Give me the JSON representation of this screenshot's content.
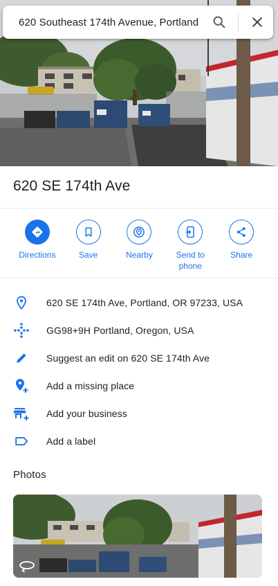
{
  "search": {
    "query": "620 Southeast 174th Avenue, Portland",
    "search_icon": "search-icon",
    "close_icon": "close-icon"
  },
  "place": {
    "title": "620 SE 174th Ave"
  },
  "actions": [
    {
      "label": "Directions",
      "icon": "directions-icon",
      "filled": true
    },
    {
      "label": "Save",
      "icon": "bookmark-icon",
      "filled": false
    },
    {
      "label": "Nearby",
      "icon": "nearby-icon",
      "filled": false
    },
    {
      "label": "Send to\nphone",
      "icon": "send-to-phone-icon",
      "filled": false
    },
    {
      "label": "Share",
      "icon": "share-icon",
      "filled": false
    }
  ],
  "details": [
    {
      "text": "620 SE 174th Ave, Portland, OR 97233, USA",
      "icon": "location-pin-icon"
    },
    {
      "text": "GG98+9H Portland, Oregon, USA",
      "icon": "plus-code-icon"
    },
    {
      "text": "Suggest an edit on 620 SE 174th Ave",
      "icon": "pencil-icon"
    },
    {
      "text": "Add a missing place",
      "icon": "add-place-icon"
    },
    {
      "text": "Add your business",
      "icon": "add-business-icon"
    },
    {
      "text": "Add a label",
      "icon": "label-icon"
    }
  ],
  "photos": {
    "heading": "Photos",
    "badge_icon": "panorama-360-icon"
  },
  "colors": {
    "accent": "#1a73e8",
    "text": "#202124",
    "divider": "#e8eaed"
  }
}
